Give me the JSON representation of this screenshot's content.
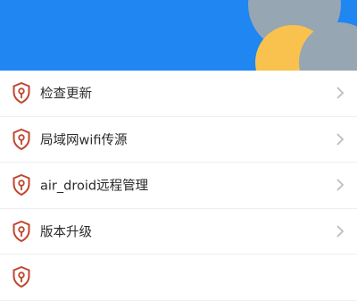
{
  "header": {
    "background_color": "#1f86f2",
    "decor_grey": "#96a6b2",
    "decor_yellow": "#f9c24f"
  },
  "menu": {
    "items": [
      {
        "label": "检查更新",
        "icon": "shield-key-icon"
      },
      {
        "label": "局域网wifi传源",
        "icon": "shield-key-icon"
      },
      {
        "label": "air_droid远程管理",
        "icon": "shield-key-icon"
      },
      {
        "label": "版本升级",
        "icon": "shield-key-icon"
      },
      {
        "label": "",
        "icon": "shield-key-icon"
      }
    ],
    "icon_color": "#c0462f",
    "chevron_color": "#bdbdbd"
  }
}
